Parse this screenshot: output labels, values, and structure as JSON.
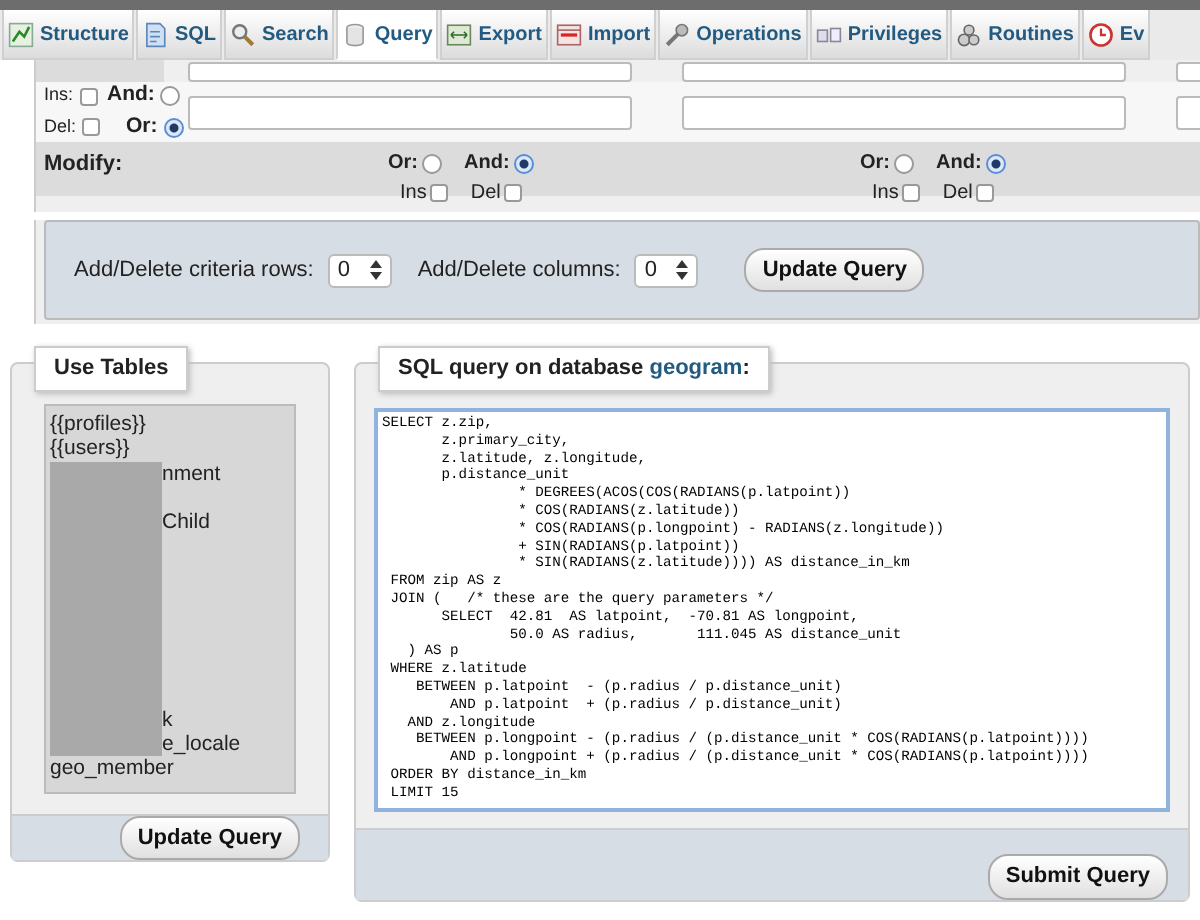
{
  "tabs": [
    {
      "label": "Structure",
      "selected": false
    },
    {
      "label": "SQL",
      "selected": false
    },
    {
      "label": "Search",
      "selected": false
    },
    {
      "label": "Query",
      "selected": true
    },
    {
      "label": "Export",
      "selected": false
    },
    {
      "label": "Import",
      "selected": false
    },
    {
      "label": "Operations",
      "selected": false
    },
    {
      "label": "Privileges",
      "selected": false
    },
    {
      "label": "Routines",
      "selected": false
    },
    {
      "label": "Ev",
      "selected": false
    }
  ],
  "criteria": {
    "row_actions": [
      {
        "label": "Ins:",
        "checked": false
      },
      {
        "label": "Del:",
        "checked": false
      }
    ],
    "row_operators": [
      {
        "label": "And:",
        "selected": false
      },
      {
        "label": "Or:",
        "selected": true
      }
    ],
    "modify": {
      "label": "Modify:",
      "columns": [
        {
          "operators": [
            {
              "label": "Or:",
              "selected": false
            },
            {
              "label": "And:",
              "selected": true
            }
          ],
          "actions": [
            {
              "label": "Ins",
              "checked": false
            },
            {
              "label": "Del",
              "checked": false
            }
          ]
        },
        {
          "operators": [
            {
              "label": "Or:",
              "selected": false
            },
            {
              "label": "And:",
              "selected": true
            }
          ],
          "actions": [
            {
              "label": "Ins",
              "checked": false
            },
            {
              "label": "Del",
              "checked": false
            }
          ]
        }
      ]
    }
  },
  "adjust": {
    "controls": [
      {
        "label": "Add/Delete criteria rows:",
        "value": "0"
      },
      {
        "label": "Add/Delete columns:",
        "value": "0"
      }
    ],
    "button": "Update Query"
  },
  "use_tables": {
    "legend": "Use Tables",
    "items": [
      {
        "text": "{{profiles}}",
        "redacted": false
      },
      {
        "text": "{{users}}",
        "redacted": false
      },
      {
        "text": "nment",
        "redacted": true
      },
      {
        "redacted": true
      },
      {
        "text": "Child",
        "redacted": true
      },
      {
        "redacted": true
      },
      {
        "redacted": true
      },
      {
        "redacted": true
      },
      {
        "redacted": true
      },
      {
        "redacted": true
      },
      {
        "redacted": true
      },
      {
        "redacted": true
      },
      {
        "text": "k",
        "redacted": true
      },
      {
        "text": "e_locale",
        "redacted": true
      },
      {
        "text": "geo_member",
        "redacted": false
      }
    ],
    "button": "Update Query"
  },
  "sql_panel": {
    "legend": "SQL query on database ",
    "database": "geogram",
    "legend_end": ":",
    "query": "SELECT z.zip,\n       z.primary_city,\n       z.latitude, z.longitude,\n       p.distance_unit\n                * DEGREES(ACOS(COS(RADIANS(p.latpoint))\n                * COS(RADIANS(z.latitude))\n                * COS(RADIANS(p.longpoint) - RADIANS(z.longitude))\n                + SIN(RADIANS(p.latpoint))\n                * SIN(RADIANS(z.latitude)))) AS distance_in_km\n FROM zip AS z\n JOIN (   /* these are the query parameters */\n       SELECT  42.81  AS latpoint,  -70.81 AS longpoint,\n               50.0 AS radius,       111.045 AS distance_unit\n   ) AS p\n WHERE z.latitude\n    BETWEEN p.latpoint  - (p.radius / p.distance_unit)\n        AND p.latpoint  + (p.radius / p.distance_unit)\n   AND z.longitude\n    BETWEEN p.longpoint - (p.radius / (p.distance_unit * COS(RADIANS(p.latpoint))))\n        AND p.longpoint + (p.radius / (p.distance_unit * COS(RADIANS(p.latpoint))))\n ORDER BY distance_in_km\n LIMIT 15",
    "button": "Submit Query"
  }
}
